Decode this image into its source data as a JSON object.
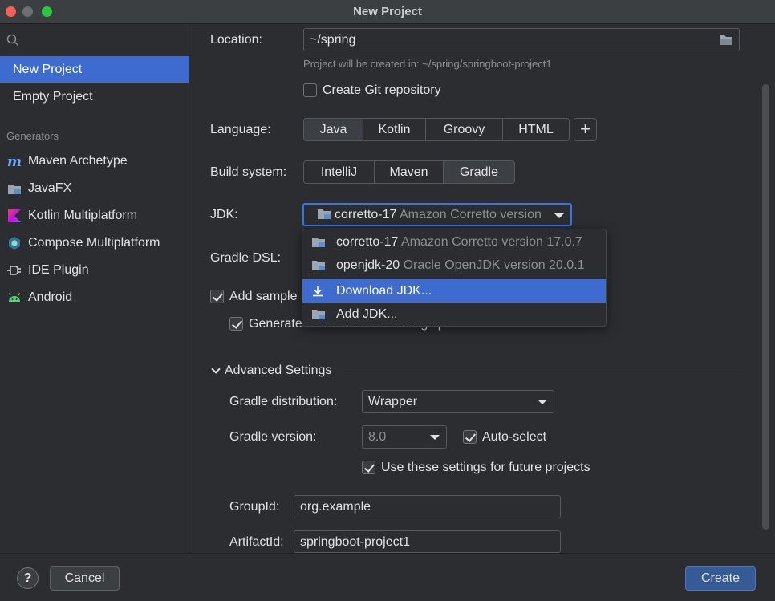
{
  "window": {
    "title": "New Project"
  },
  "sidebar": {
    "items": [
      {
        "label": "New Project",
        "selected": true
      },
      {
        "label": "Empty Project",
        "selected": false
      }
    ],
    "section_title": "Generators",
    "generators": [
      {
        "label": "Maven Archetype",
        "icon": "maven-icon"
      },
      {
        "label": "JavaFX",
        "icon": "javafx-icon"
      },
      {
        "label": "Kotlin Multiplatform",
        "icon": "kotlin-icon"
      },
      {
        "label": "Compose Multiplatform",
        "icon": "compose-icon"
      },
      {
        "label": "IDE Plugin",
        "icon": "plugin-icon"
      },
      {
        "label": "Android",
        "icon": "android-icon"
      }
    ]
  },
  "form": {
    "location_label": "Location:",
    "location_value": "~/spring",
    "location_hint": "Project will be created in: ~/spring/springboot-project1",
    "git_label": "Create Git repository",
    "git_checked": false,
    "language_label": "Language:",
    "languages": [
      "Java",
      "Kotlin",
      "Groovy",
      "HTML"
    ],
    "language_selected": "Java",
    "build_label": "Build system:",
    "build_systems": [
      "IntelliJ",
      "Maven",
      "Gradle"
    ],
    "build_selected": "Gradle",
    "jdk_label": "JDK:",
    "jdk_name": "corretto-17",
    "jdk_desc": "Amazon Corretto version",
    "gradle_dsl_label": "Gradle DSL:",
    "sample_label": "Add sample",
    "sample_checked": true,
    "onboarding_label": "Generate code with onboarding tips",
    "onboarding_checked": true
  },
  "jdk_dropdown": {
    "items": [
      {
        "name": "corretto-17",
        "desc": "Amazon Corretto version 17.0.7",
        "selected": false
      },
      {
        "name": "openjdk-20",
        "desc": "Oracle OpenJDK version 20.0.1",
        "selected": false
      },
      {
        "name": "Download JDK...",
        "desc": "",
        "selected": true
      },
      {
        "name": "Add JDK...",
        "desc": "",
        "selected": false
      }
    ]
  },
  "advanced": {
    "title": "Advanced Settings",
    "distribution_label": "Gradle distribution:",
    "distribution_value": "Wrapper",
    "version_label": "Gradle version:",
    "version_value": "8.0",
    "auto_select_label": "Auto-select",
    "auto_select_checked": true,
    "future_label": "Use these settings for future projects",
    "future_checked": true,
    "group_label": "GroupId:",
    "group_value": "org.example",
    "artifact_label": "ArtifactId:",
    "artifact_value": "springboot-project1"
  },
  "footer": {
    "help_label": "?",
    "cancel_label": "Cancel",
    "create_label": "Create"
  }
}
